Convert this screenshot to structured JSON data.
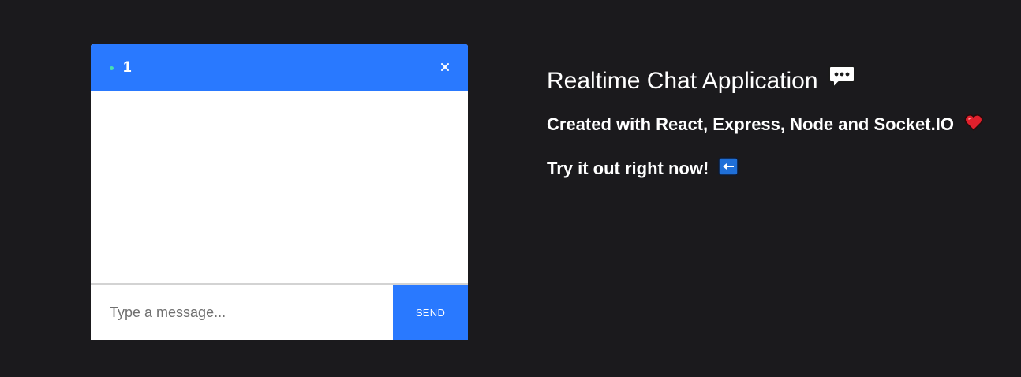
{
  "chat": {
    "room_name": "1",
    "input_placeholder": "Type a message...",
    "send_label": "SEND",
    "icons": {
      "online": "online-dot-icon",
      "close": "close-icon"
    }
  },
  "info": {
    "title": "Realtime Chat Application",
    "subtitle": "Created with React, Express, Node and Socket.IO",
    "cta": "Try it out right now!",
    "icons": {
      "title": "speech-bubble-icon",
      "subtitle": "heart-icon",
      "cta": "left-arrow-icon"
    }
  },
  "colors": {
    "background": "#1b1a1d",
    "accent": "#2979ff",
    "online": "#48e0b0",
    "heart": "#e0202c"
  }
}
